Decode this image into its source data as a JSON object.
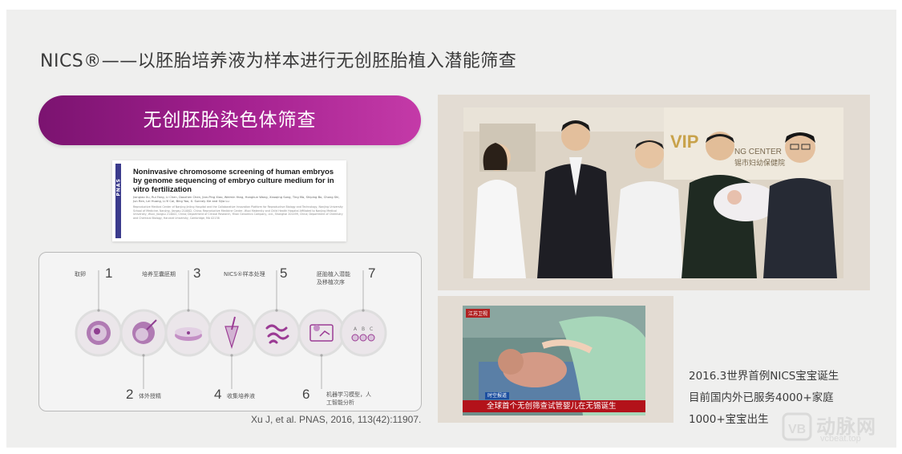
{
  "slide": {
    "title": "NICS®——以胚胎培养液为样本进行无创胚胎植入潜能筛查",
    "pill_label": "无创胚胎染色体筛查"
  },
  "paper": {
    "journal": "PNAS",
    "title": "Noninvasive chromosome screening of human embryos by genome sequencing of embryo culture medium for in vitro fertilization",
    "authors": "Jiangiao Xu, Rui Fang, Li Chen, Daozhen Chen, Jian-Ping Xiao, Weimin Yang, Hongkun Wang, Xiaoqing Song, Ting Ma, Shiping Bo, Chong Shi, Jun Ren, Lei Huang, Li-Yi Cai, Bing Yao, X. Sunney Xie and Sijia Lu",
    "affiliation": "Reproductive Medical Center of Nanjing Jinling Hospital and the Collaborative Innovation Platform for Reproductive Biology and Technology, Nanjing University School of Medicine, Nanjing, Jiangsu 210002, China; Reproductive Medicine Center, Wuxi Maternity and Child Health Hospital Affiliated to Nanjing Medical University, Wuxi, Jiangsu 214002, China; Department of Clinical Research, Yikon Genomics Company, Ltd., Shanghai 201499, China; Department of Chemistry and Chemical Biology, Harvard University, Cambridge, MA 02138"
  },
  "flow": {
    "steps": [
      {
        "num": "1",
        "label": "取卵"
      },
      {
        "num": "2",
        "label": "体外授精"
      },
      {
        "num": "3",
        "label": "培养至囊胚期"
      },
      {
        "num": "4",
        "label": "收集培养液"
      },
      {
        "num": "5",
        "label": "NICS®样本处理"
      },
      {
        "num": "6",
        "label_line1": "机器学习模型，人",
        "label_line2": "工智能分析"
      },
      {
        "num": "7",
        "label_line1": "胚胎植入潜能",
        "label_line2": "及移植次序"
      }
    ],
    "abc": [
      "A",
      "B",
      "C"
    ]
  },
  "citation": "Xu J, et al. PNAS, 2016, 113(42):11907.",
  "photo1": {
    "sign_text": "VIP",
    "sign_sub": "NG CENTER",
    "sign_cn": "锡市妇幼保健院"
  },
  "news": {
    "logo": "江苏卫视",
    "tag": "时空报道",
    "caption": "全球首个无创筛查试管婴儿在无锡诞生"
  },
  "facts": [
    "2016.3世界首例NICS宝宝诞生",
    "目前国内外已服务4000+家庭",
    "1000+宝宝出生"
  ],
  "watermark": {
    "text": "动脉网",
    "url": "vcbeat.top"
  },
  "colors": {
    "pill_start": "#7b1370",
    "pill_end": "#c43aa8",
    "icon_purple": "#9b3b94"
  }
}
